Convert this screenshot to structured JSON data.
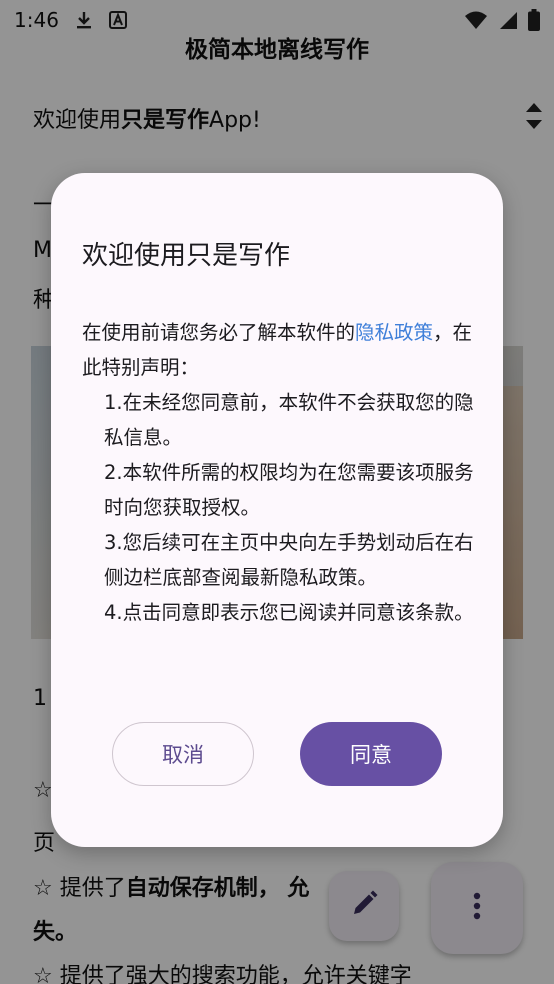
{
  "status_bar": {
    "time": "1:46"
  },
  "app": {
    "title": "极简本地离线写作"
  },
  "document": {
    "line1_prefix": "欢迎使用",
    "line1_bold": "只是写作",
    "line1_suffix": "App!",
    "line2": "一",
    "line3": "M",
    "line4": "种",
    "line5": "1",
    "line6": "☆",
    "line7": "页",
    "line8_prefix": "☆ 提供了",
    "line8_bold": "自动保存机制",
    "line8_suffix": "，    允",
    "line9": "失。",
    "line10": "☆ 提供了强大的搜索功能，允许关键字"
  },
  "dialog": {
    "title": "欢迎使用只是写作",
    "intro_before_link": "在使用前请您务必了解本软件的",
    "privacy_link": "隐私政策",
    "intro_after_link": "，在此特别声明：",
    "items": [
      "1.在未经您同意前，本软件不会获取您的隐私信息。",
      "2.本软件所需的权限均为在您需要该项服务时向您获取授权。",
      "3.您后续可在主页中央向左手势划动后在右侧边栏底部查阅最新隐私政策。",
      "4.点击同意即表示您已阅读并同意该条款。"
    ],
    "cancel_label": "取消",
    "agree_label": "同意"
  },
  "colors": {
    "accent": "#6750a4",
    "link": "#3f7fd9",
    "dialog_bg": "#fdf8fd"
  },
  "icons": [
    "download-icon",
    "text-a-icon",
    "wifi-icon",
    "signal-icon",
    "battery-icon",
    "scroll-arrows-icon",
    "edit-icon",
    "more-vert-icon"
  ]
}
